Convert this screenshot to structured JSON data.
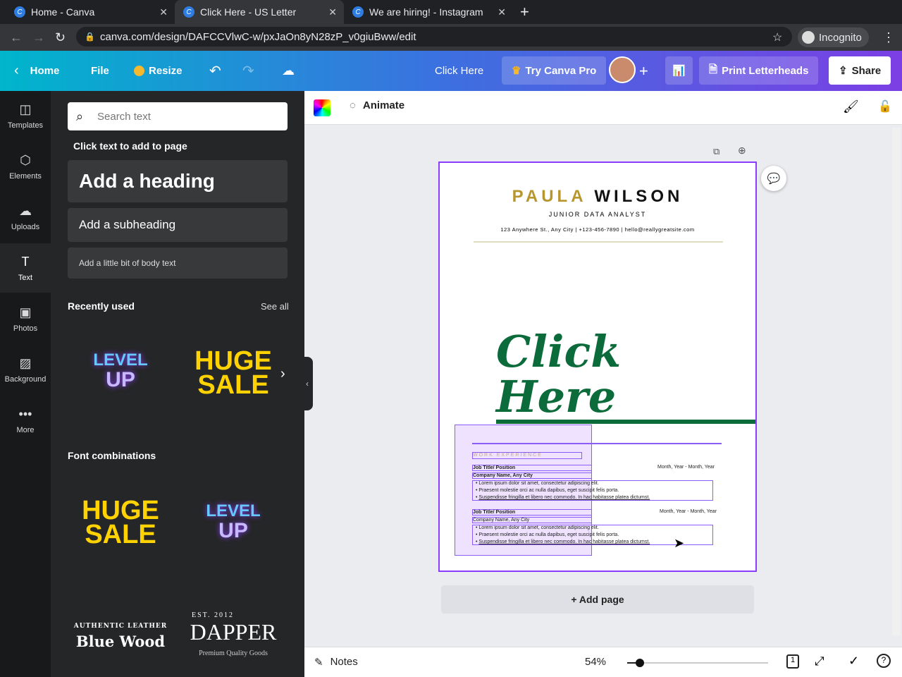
{
  "browser": {
    "tabs": [
      {
        "title": "Home - Canva"
      },
      {
        "title": "Click Here - US Letter"
      },
      {
        "title": "We are hiring! - Instagram"
      }
    ],
    "url": "canva.com/design/DAFCCVlwC-w/pxJaOn8yN28zP_v0giuBww/edit",
    "incognito": "Incognito"
  },
  "topbar": {
    "home": "Home",
    "file": "File",
    "resize": "Resize",
    "doc_title": "Click Here",
    "try_pro": "Try Canva Pro",
    "print": "Print Letterheads",
    "share": "Share"
  },
  "rail": [
    {
      "label": "Templates"
    },
    {
      "label": "Elements"
    },
    {
      "label": "Uploads"
    },
    {
      "label": "Text"
    },
    {
      "label": "Photos"
    },
    {
      "label": "Background"
    },
    {
      "label": "More"
    }
  ],
  "panel": {
    "search_placeholder": "Search text",
    "click_hint": "Click text to add to page",
    "heading": "Add a heading",
    "subheading": "Add a subheading",
    "body": "Add a little bit of body text",
    "recent_title": "Recently used",
    "see_all": "See all",
    "fonts_title": "Font combinations",
    "graphics": {
      "level": "LEVEL",
      "up": "UP",
      "huge": "HUGE",
      "sale": "SALE",
      "authentic": "AUTHENTIC LEATHER",
      "bluewood": "Blue Wood",
      "est": "EST. 2012",
      "dapper": "DAPPER",
      "premium": "Premium Quality Goods"
    }
  },
  "canvas": {
    "animate": "Animate",
    "add_page": "+ Add page",
    "resume": {
      "first": "PAULA",
      "last": "WILSON",
      "role": "JUNIOR DATA ANALYST",
      "address": "123 Anywhere St., Any City",
      "phone": "+123-456-7890",
      "email": "hello@reallygreatsite.com",
      "click_here": "Click Here",
      "section": "WORK EXPERIENCE",
      "jobs": [
        {
          "title": "Job Title/ Position",
          "company": "Company Name, Any City",
          "dates": "Month, Year - Month, Year"
        },
        {
          "title": "Job Title/ Position",
          "company": "Company Name, Any City",
          "dates": "Month, Year - Month, Year"
        }
      ],
      "bullets": [
        "Lorem ipsum dolor sit amet, consectetur adipiscing elit.",
        "Praesent molestie orci ac nulla dapibus, eget suscipit felis porta.",
        "Suspendisse fringilla et libero nec commodo. In hac habitasse platea dictumst."
      ]
    }
  },
  "bottom": {
    "notes": "Notes",
    "zoom": "54%",
    "zoom_value": 54,
    "page_count": "1"
  },
  "colors": {
    "accent": "#8b3dff",
    "gold": "#b8962e",
    "green": "#0c6b3a"
  }
}
